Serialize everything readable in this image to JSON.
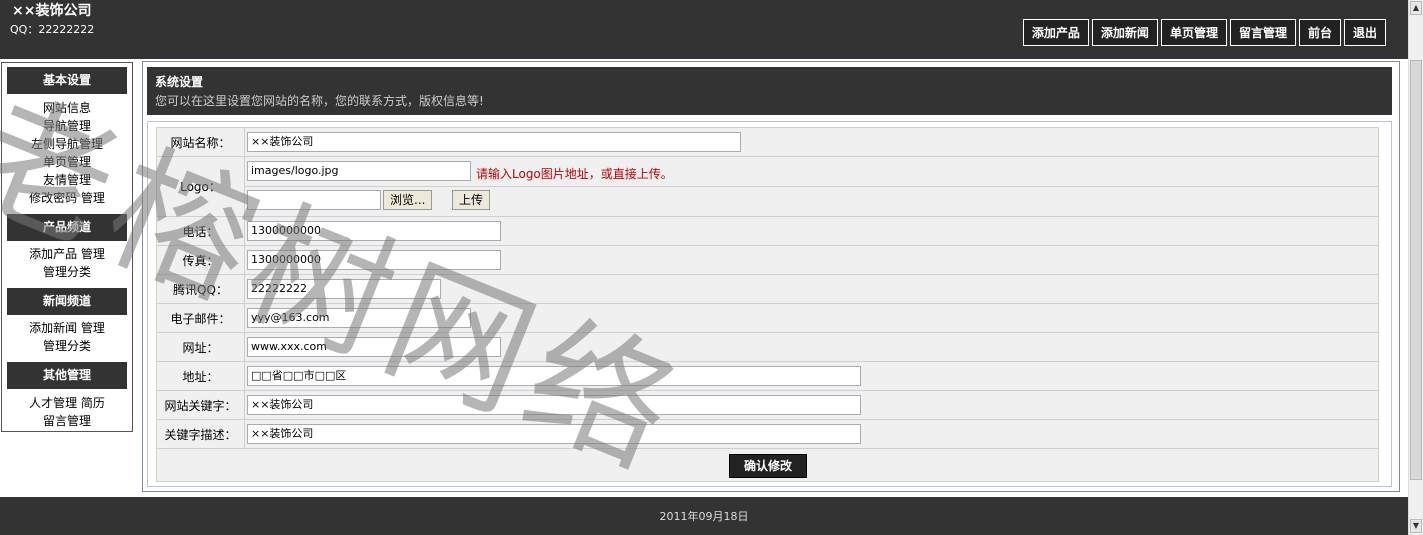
{
  "header": {
    "site_name": "××装饰公司",
    "qq": "QQ：22222222",
    "nav": [
      "添加产品",
      "添加新闻",
      "单页管理",
      "留言管理",
      "前台",
      "退出"
    ]
  },
  "sidebar": {
    "groups": [
      {
        "title": "基本设置",
        "items": [
          "网站信息",
          "导航管理",
          "左侧导航管理",
          "单页管理",
          "友情管理",
          "修改密码 管理"
        ]
      },
      {
        "title": "产品频道",
        "items": [
          "添加产品 管理",
          "管理分类"
        ]
      },
      {
        "title": "新闻频道",
        "items": [
          "添加新闻 管理",
          "管理分类"
        ]
      },
      {
        "title": "其他管理",
        "items": [
          "人才管理 简历",
          "留言管理"
        ]
      }
    ]
  },
  "panel": {
    "title": "系统设置",
    "desc": "您可以在这里设置您网站的名称，您的联系方式，版权信息等!"
  },
  "form": {
    "site_name_label": "网站名称：",
    "site_name_value": "××装饰公司",
    "logo_label": "Logo：",
    "logo_value": "images/logo.jpg",
    "logo_hint": "请输入Logo图片地址，或直接上传。",
    "browse_label": "浏览...",
    "upload_label": "上传",
    "phone_label": "电话：",
    "phone_value": "1300000000",
    "fax_label": "传真：",
    "fax_value": "1300000000",
    "qq_label": "腾讯QQ：",
    "qq_value": "22222222",
    "email_label": "电子邮件：",
    "email_value": "yyy@163.com",
    "url_label": "网址：",
    "url_value": "www.xxx.com",
    "address_label": "地址：",
    "address_value": "□□省□□市□□区",
    "keywords_label": "网站关键字：",
    "keywords_value": "××装饰公司",
    "description_label": "关键字描述：",
    "description_value": "××装饰公司",
    "submit_label": "确认修改"
  },
  "footer": {
    "date": "2011年09月18日"
  },
  "watermark": "老榕树网络"
}
